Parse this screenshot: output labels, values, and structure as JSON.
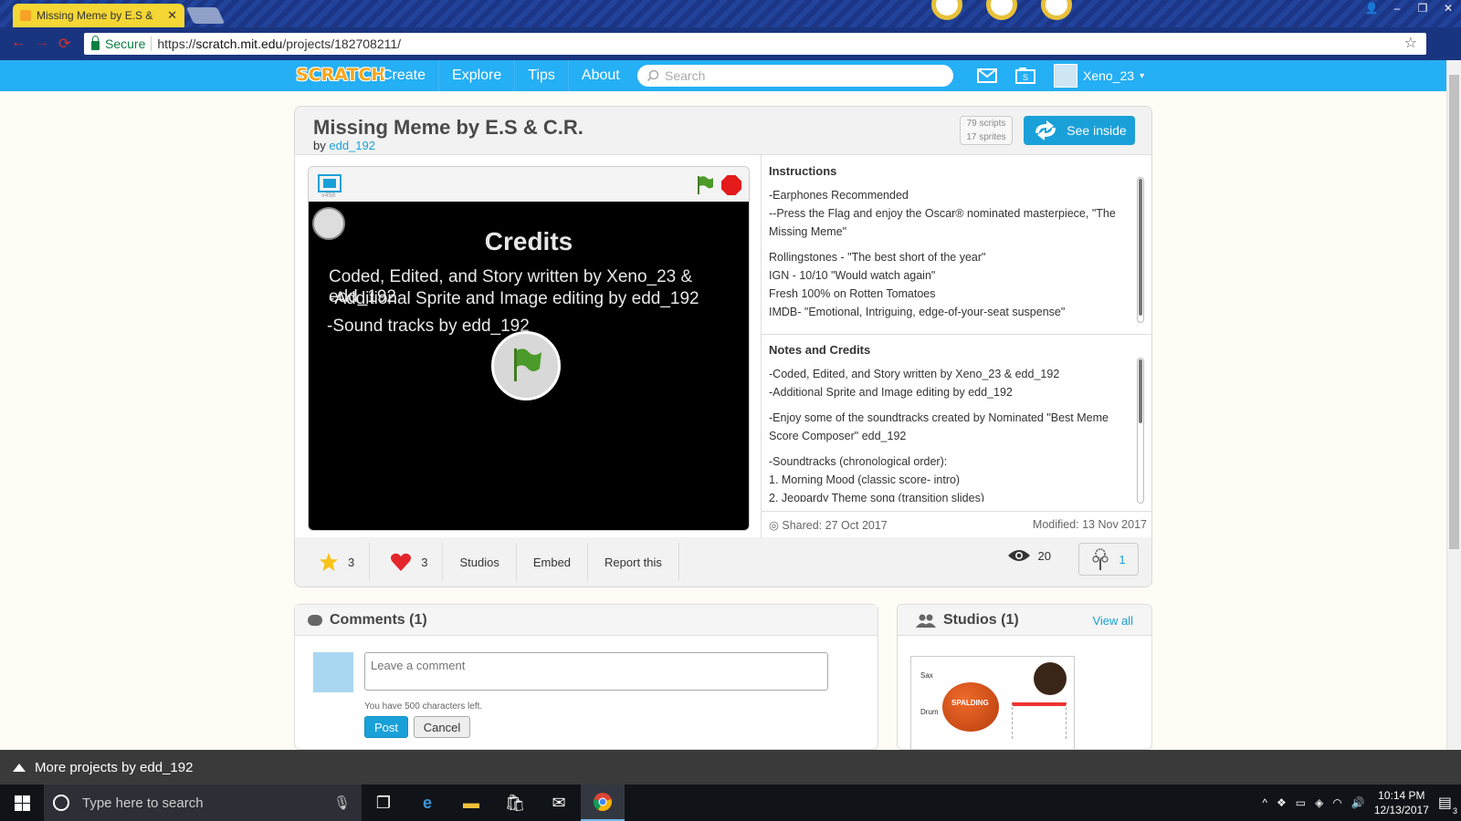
{
  "browser": {
    "tab_title": "Missing Meme by E.S &",
    "tab_close": "✕",
    "secure_label": "Secure",
    "url_prefix": "https://",
    "url_host": "scratch.mit.edu",
    "url_path": "/projects/182708211/",
    "window_controls": [
      "👤",
      "–",
      "❐",
      "✕"
    ]
  },
  "nav": {
    "logo": "SCRATCH",
    "links": [
      "Create",
      "Explore",
      "Tips",
      "About"
    ],
    "search_placeholder": "Search",
    "username": "Xeno_23",
    "user_caret": "▾"
  },
  "project": {
    "title": "Missing Meme by E.S & C.R.",
    "by_label": "by",
    "author": "edd_192",
    "scripts": "79 scripts",
    "sprites": "17 sprites",
    "see_inside": "See inside",
    "version": "v458",
    "stage": {
      "title": "Credits",
      "line1": "Coded, Edited, and Story written by Xeno_23 & edd_192",
      "line2": "-Additional Sprite and Image editing by edd_192",
      "line3": "-Sound tracks by edd_192"
    },
    "instructions_title": "Instructions",
    "instructions": [
      "-Earphones Recommended",
      "--Press the Flag and enjoy the Oscar® nominated masterpiece, \"The Missing Meme\""
    ],
    "reviews": [
      "Rollingstones - \"The best short of the year\"",
      "IGN - 10/10 \"Would watch again\"",
      "Fresh 100% on Rotten Tomatoes",
      "IMDB- \"Emotional, Intriguing, edge-of-your-seat suspense\""
    ],
    "notes_title": "Notes and Credits",
    "notes1": [
      "-Coded, Edited, and Story written by Xeno_23 & edd_192",
      "-Additional Sprite and Image editing by edd_192"
    ],
    "notes2": "-Enjoy some of the soundtracks created by Nominated \"Best Meme Score Composer\" edd_192",
    "notes3": [
      "-Soundtracks (chronological order):",
      "1. Morning Mood (classic score- intro)",
      "2. Jeopardy Theme song (transition slides)"
    ],
    "shared": "Shared: 27 Oct 2017",
    "modified": "Modified: 13 Nov 2017",
    "favorites": "3",
    "loves": "3",
    "studios_btn": "Studios",
    "embed_btn": "Embed",
    "report_btn": "Report this",
    "views": "20",
    "remixes": "1"
  },
  "comments": {
    "title": "Comments (1)",
    "placeholder": "Leave a comment",
    "chars_left": "You have 500 characters left.",
    "post": "Post",
    "cancel": "Cancel"
  },
  "studios": {
    "title": "Studios (1)",
    "view_all": "View all",
    "thumb_labels": [
      "Sax",
      "Drum"
    ],
    "ball_text": "SPALDING"
  },
  "more_projects": "More projects by edd_192",
  "taskbar": {
    "search_placeholder": "Type here to search",
    "time": "10:14 PM",
    "date": "12/13/2017",
    "notif_count": "3"
  },
  "colors": {
    "scratch_blue": "#25aff4",
    "link_blue": "#1aa0d8",
    "stop_red": "#e31b1b",
    "love_red": "#e3262b",
    "star_yellow": "#f9c31a"
  }
}
